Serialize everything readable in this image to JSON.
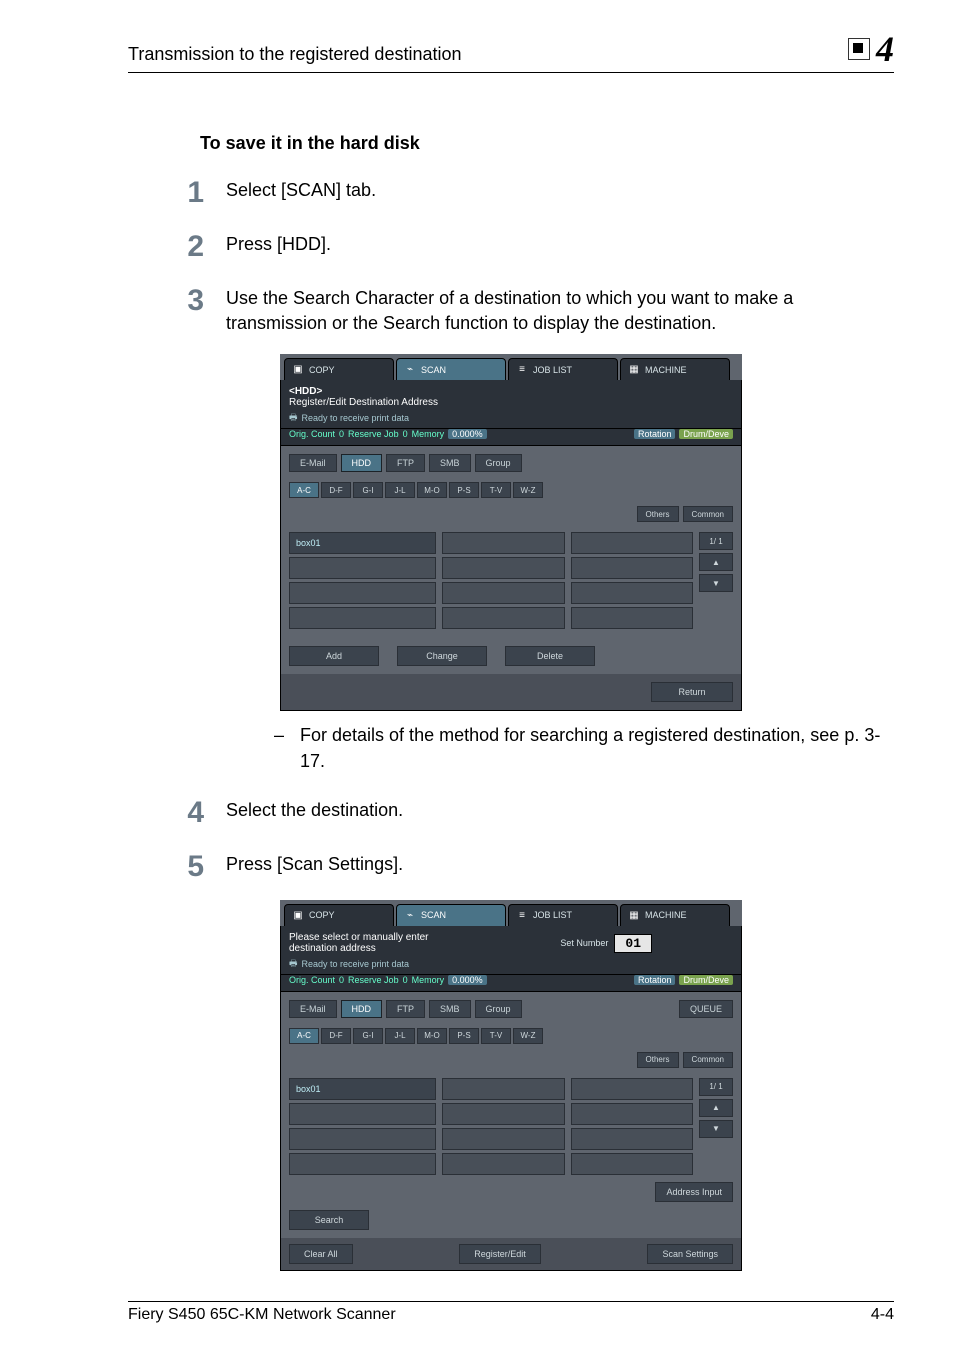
{
  "header": {
    "title": "Transmission to the registered destination",
    "section_number": "4"
  },
  "section_heading": "To save it in the hard disk",
  "steps": {
    "s1": {
      "num": "1",
      "text": "Select [SCAN] tab."
    },
    "s2": {
      "num": "2",
      "text": "Press [HDD]."
    },
    "s3": {
      "num": "3",
      "text": "Use the Search Character of a destination to which you want to make a transmission or the Search function to display the destination."
    },
    "s3_note": "For details of the method for searching a registered destination, see p. 3-17.",
    "s4": {
      "num": "4",
      "text": "Select the destination."
    },
    "s5": {
      "num": "5",
      "text": "Press [Scan Settings]."
    }
  },
  "screenshot1": {
    "tabs": {
      "copy": "COPY",
      "scan": "SCAN",
      "joblist": "JOB LIST",
      "machine": "MACHINE"
    },
    "status_title": "<HDD>",
    "status_sub": "Register/Edit Destination Address",
    "status_ready": "Ready to receive print data",
    "status_row": {
      "orig_label": "Orig. Count",
      "orig_val": "0",
      "reserve_label": "Reserve Job",
      "reserve_val": "0",
      "memory_label": "Memory",
      "memory_val": "0.000%",
      "rotation": "Rotation",
      "drumdev": "Drum/Deve"
    },
    "subtabs": {
      "email": "E-Mail",
      "hdd": "HDD",
      "ftp": "FTP",
      "smb": "SMB",
      "group": "Group"
    },
    "alpha": [
      "A-C",
      "D-F",
      "G-I",
      "J-L",
      "M-O",
      "P-S",
      "T-V",
      "W-Z"
    ],
    "pills": {
      "others": "Others",
      "common": "Common"
    },
    "first_item": "box01",
    "pager": {
      "page": "1/ 1",
      "up": "▲",
      "down": "▼"
    },
    "actions": {
      "add": "Add",
      "change": "Change",
      "delete": "Delete"
    },
    "return_btn": "Return"
  },
  "screenshot2": {
    "tabs": {
      "copy": "COPY",
      "scan": "SCAN",
      "joblist": "JOB LIST",
      "machine": "MACHINE"
    },
    "status_title": "Please select or manually enter",
    "status_sub": "destination address",
    "status_ready": "Ready to receive print data",
    "set_number_label": "Set Number",
    "set_number_value": "01",
    "status_row": {
      "orig_label": "Orig. Count",
      "orig_val": "0",
      "reserve_label": "Reserve Job",
      "reserve_val": "0",
      "memory_label": "Memory",
      "memory_val": "0.000%",
      "rotation": "Rotation",
      "drumdev": "Drum/Deve"
    },
    "subtabs": {
      "email": "E-Mail",
      "hdd": "HDD",
      "ftp": "FTP",
      "smb": "SMB",
      "group": "Group",
      "queue": "QUEUE"
    },
    "alpha": [
      "A-C",
      "D-F",
      "G-I",
      "J-L",
      "M-O",
      "P-S",
      "T-V",
      "W-Z"
    ],
    "pills": {
      "others": "Others",
      "common": "Common"
    },
    "first_item": "box01",
    "pager": {
      "page": "1/ 1",
      "up": "▲",
      "down": "▼"
    },
    "address_input": "Address Input",
    "search": "Search",
    "clear_all": "Clear All",
    "register_edit": "Register/Edit",
    "scan_settings": "Scan Settings"
  },
  "footer": {
    "left": "Fiery S450 65C-KM Network Scanner",
    "right": "4-4"
  }
}
